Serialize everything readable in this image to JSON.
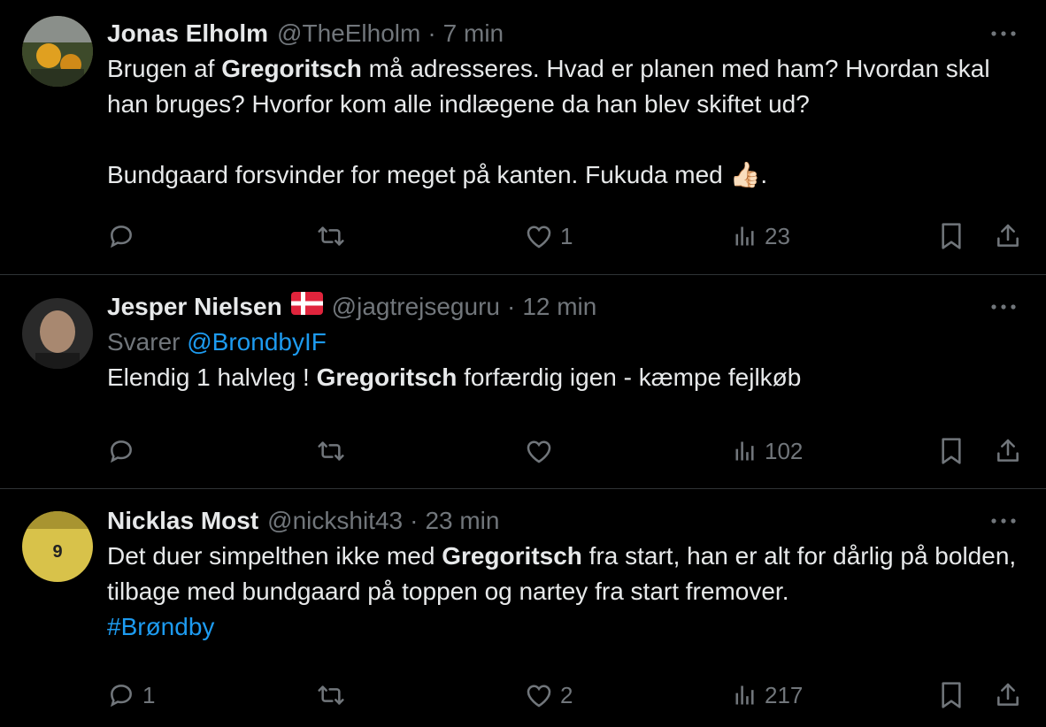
{
  "tweets": [
    {
      "name": "Jonas Elholm",
      "handle": "@TheElholm",
      "time": "7 min",
      "text_parts": [
        "Brugen af ",
        "Gregoritsch",
        " må adresseres. Hvad er planen med ham? Hvordan skal han bruges? Hvorfor kom alle indlægene da han blev skiftet ud?"
      ],
      "text2": "Bundgaard forsvinder for meget på kanten. Fukuda med ",
      "emoji": "👍🏻",
      "text2_end": ".",
      "replies": "",
      "reposts": "",
      "likes": "1",
      "views": "23"
    },
    {
      "name": "Jesper Nielsen",
      "flag": "danish-flag",
      "handle": "@jagtrejseguru",
      "time": "12 min",
      "reply_prefix": "Svarer ",
      "reply_to": "@BrondbyIF",
      "text_parts": [
        "Elendig 1 halvleg ! ",
        "Gregoritsch",
        " forfærdig igen - kæmpe fejlkøb"
      ],
      "replies": "",
      "reposts": "",
      "likes": "",
      "views": "102"
    },
    {
      "name": "Nicklas Most",
      "handle": "@nickshit43",
      "time": "23 min",
      "text_parts": [
        "Det duer simpelthen ikke med ",
        "Gregoritsch",
        " fra start, han er alt for dårlig på bolden, tilbage med bundgaard på toppen og nartey fra start fremover."
      ],
      "hashtag": "#Brøndby",
      "replies": "1",
      "reposts": "",
      "likes": "2",
      "views": "217"
    }
  ],
  "separator": "·",
  "colors": {
    "background": "#000000",
    "text": "#e7e9ea",
    "muted": "#71767b",
    "link": "#1d9bf0",
    "divider": "#2f3336"
  }
}
